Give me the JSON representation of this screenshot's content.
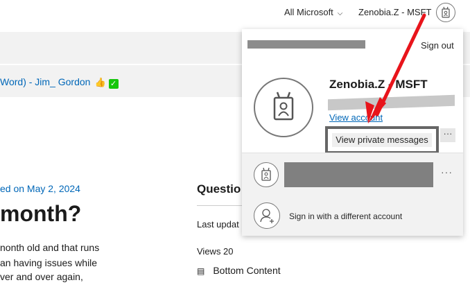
{
  "header": {
    "all_microsoft": "All Microsoft",
    "user_name": "Zenobia.Z - MSFT"
  },
  "breadcrumb": {
    "text": "Word) - Jim_ Gordon",
    "thumb": "👍",
    "check": "✓"
  },
  "article": {
    "posted": "ed on May 2, 2024",
    "heading": "month?",
    "lines": [
      "nonth old and that runs",
      "an having issues while",
      "ver and over again,"
    ]
  },
  "sidebar": {
    "title": "Questio",
    "last_updated": "Last updat",
    "views": "Views 20",
    "bottom_content": "Bottom Content"
  },
  "account_panel": {
    "sign_out": "Sign out",
    "account_name": "Zenobia.Z - MSFT",
    "view_account": "View account",
    "view_private_messages": "View private messages",
    "more_options": "···",
    "sign_in_different": "Sign in with a different account"
  },
  "colors": {
    "link": "#0067b8",
    "annotation_arrow": "#e8141b",
    "highlight_border": "#666666"
  }
}
